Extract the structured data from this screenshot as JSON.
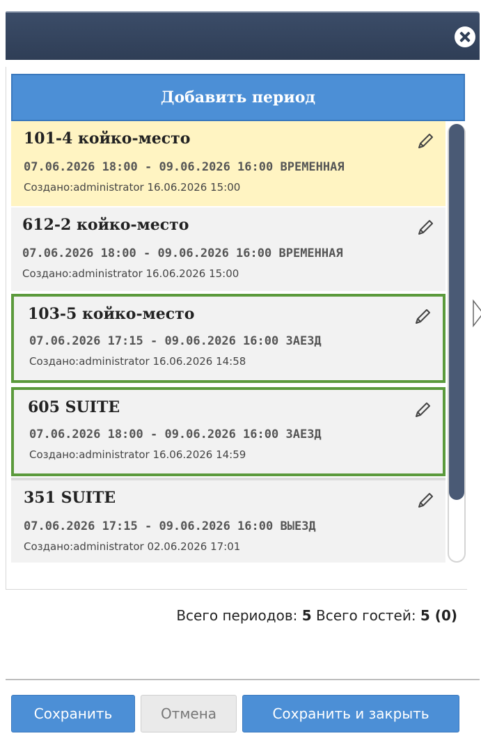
{
  "header": {
    "title": ""
  },
  "add_period_label": "Добавить период",
  "periods": [
    {
      "room": "101-4 койко-место",
      "dates": "07.06.2026 18:00 - 09.06.2026 16:00",
      "status": "ВРЕМЕННАЯ",
      "created": "Создано:administrator 16.06.2026 15:00"
    },
    {
      "room": "612-2 койко-место",
      "dates": "07.06.2026 18:00 - 09.06.2026 16:00",
      "status": "ВРЕМЕННАЯ",
      "created": "Создано:administrator 16.06.2026 15:00"
    },
    {
      "room": "103-5 койко-место",
      "dates": "07.06.2026 17:15 - 09.06.2026 16:00",
      "status": "ЗАЕЗД",
      "created": "Создано:administrator 16.06.2026 14:58"
    },
    {
      "room": "605 SUITE",
      "dates": "07.06.2026 18:00 - 09.06.2026 16:00",
      "status": "ЗАЕЗД",
      "created": "Создано:administrator 16.06.2026 14:59"
    },
    {
      "room": "351 SUITE",
      "dates": "07.06.2026 17:15 - 09.06.2026 16:00",
      "status": "ВЫЕЗД",
      "created": "Создано:administrator 02.06.2026 17:01"
    }
  ],
  "totals": {
    "periods_label": "Всего периодов:",
    "periods_value": "5",
    "guests_label": "Всего гостей:",
    "guests_value": "5 (0)"
  },
  "buttons": {
    "save": "Сохранить",
    "cancel": "Отмена",
    "save_close": "Сохранить и закрыть"
  },
  "colors": {
    "header_bg": "#2f3e56",
    "primary_button": "#4c8fd6",
    "selected_row": "#fff4c2",
    "checkin_border": "#5b9a3c",
    "row_bg": "#f2f2f2",
    "scroll_thumb": "#4a5a75"
  },
  "icons": {
    "close": "close-circle-icon",
    "edit": "pencil-icon"
  }
}
